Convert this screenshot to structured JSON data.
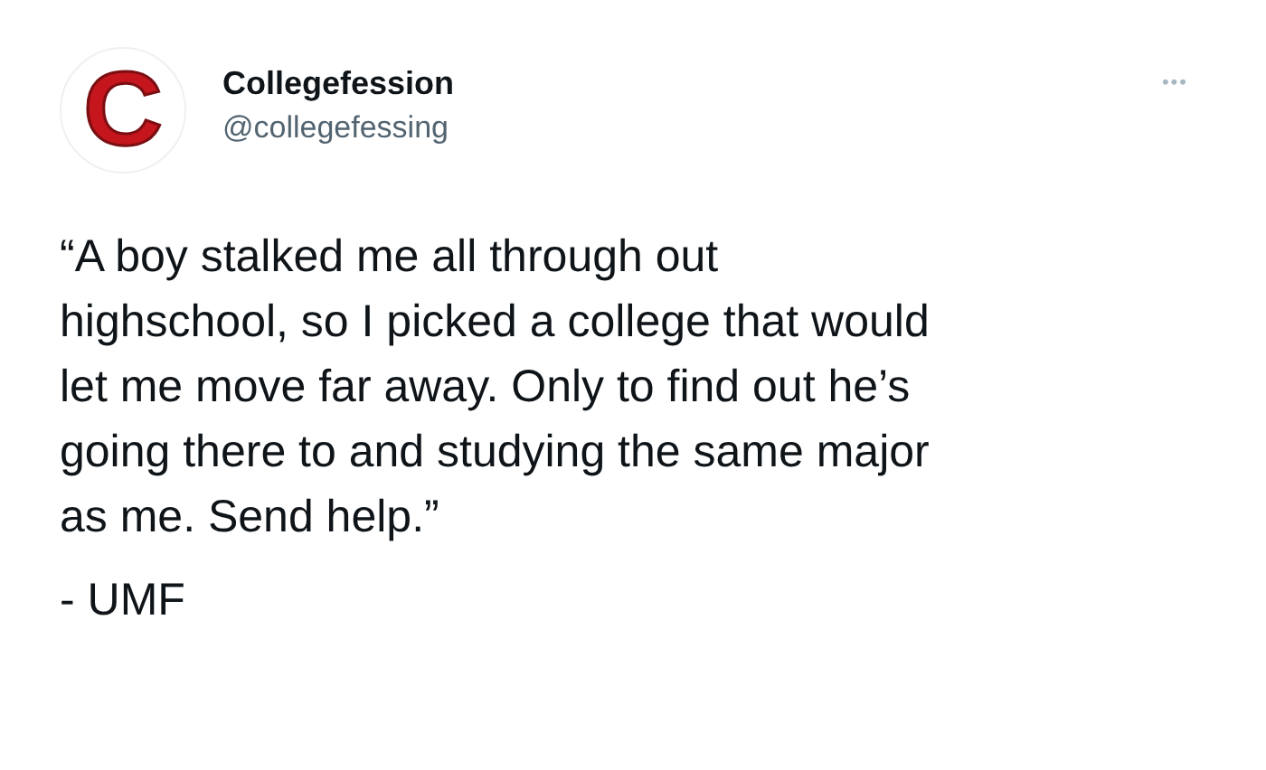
{
  "tweet": {
    "avatar_letter": "C",
    "name": "Collegefession",
    "handle": "@collegefessing",
    "more": "•••",
    "text": "“A boy stalked me all through out\nhighschool, so I picked a college that would\nlet me move far away. Only to find out he’s\ngoing there to and studying the same major\nas me. Send help.”",
    "signature": "- UMF"
  }
}
